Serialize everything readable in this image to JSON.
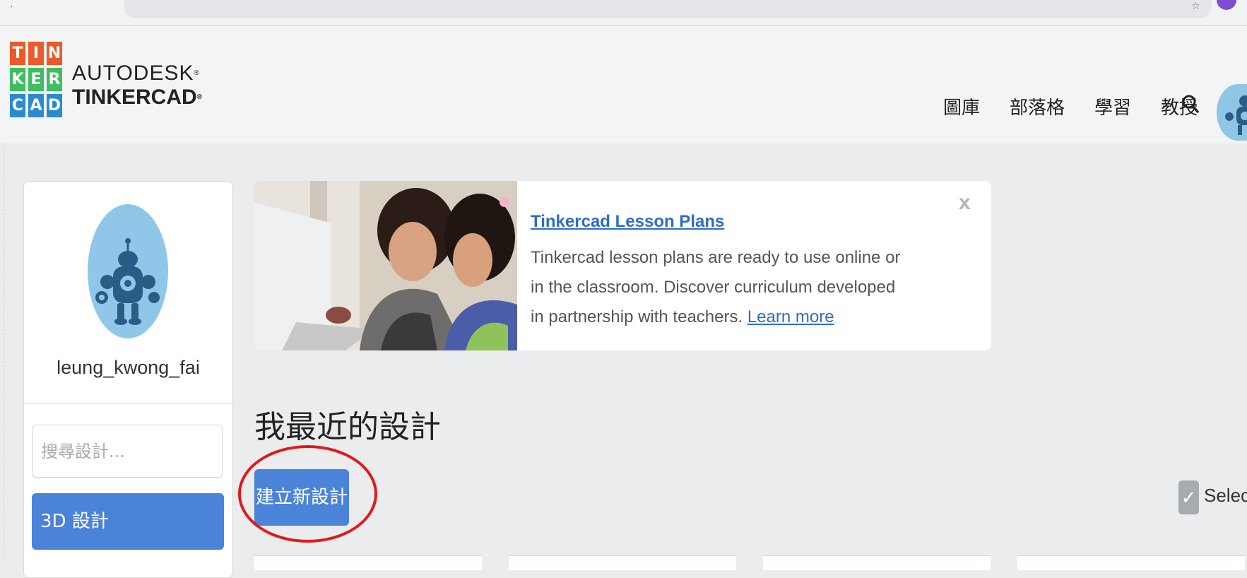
{
  "header": {
    "logo_letters": [
      "T",
      "I",
      "N",
      "K",
      "E",
      "R",
      "C",
      "A",
      "D"
    ],
    "logo_line1": "AUTODESK",
    "logo_line2": "TINKERCAD",
    "nav": [
      "圖庫",
      "部落格",
      "學習",
      "教授"
    ],
    "icons": [
      "search-icon",
      "user-avatar"
    ]
  },
  "sidebar": {
    "username": "leung_kwong_fai",
    "search_placeholder": "搜尋設計...",
    "active_item": "3D 設計"
  },
  "banner": {
    "title": "Tinkercad Lesson Plans",
    "body": "Tinkercad lesson plans are ready to use online or in the classroom. Discover curriculum developed in partnership with teachers.",
    "link": "Learn more",
    "close": "x"
  },
  "main": {
    "section_title": "我最近的設計",
    "create_button": "建立新設計",
    "select_label": "Select"
  },
  "colors": {
    "accent": "#4a83d8",
    "annotation": "#e01a1a",
    "logo_orange": "#ea5a2a",
    "logo_green": "#3ebd61",
    "logo_blue": "#2a8ad1"
  }
}
